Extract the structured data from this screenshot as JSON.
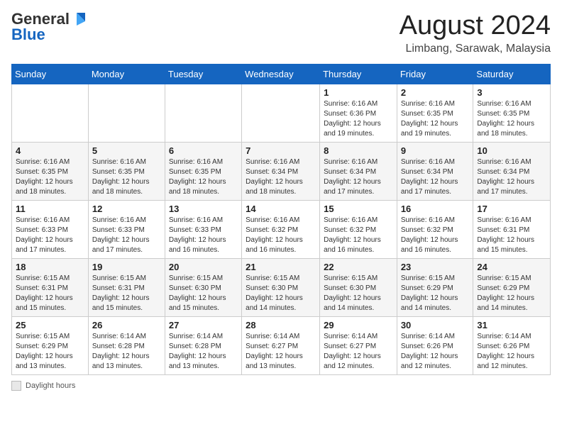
{
  "header": {
    "logo_general": "General",
    "logo_blue": "Blue",
    "month_year": "August 2024",
    "location": "Limbang, Sarawak, Malaysia"
  },
  "days_of_week": [
    "Sunday",
    "Monday",
    "Tuesday",
    "Wednesday",
    "Thursday",
    "Friday",
    "Saturday"
  ],
  "weeks": [
    [
      {
        "day": "",
        "info": ""
      },
      {
        "day": "",
        "info": ""
      },
      {
        "day": "",
        "info": ""
      },
      {
        "day": "",
        "info": ""
      },
      {
        "day": "1",
        "info": "Sunrise: 6:16 AM\nSunset: 6:36 PM\nDaylight: 12 hours\nand 19 minutes."
      },
      {
        "day": "2",
        "info": "Sunrise: 6:16 AM\nSunset: 6:35 PM\nDaylight: 12 hours\nand 19 minutes."
      },
      {
        "day": "3",
        "info": "Sunrise: 6:16 AM\nSunset: 6:35 PM\nDaylight: 12 hours\nand 18 minutes."
      }
    ],
    [
      {
        "day": "4",
        "info": "Sunrise: 6:16 AM\nSunset: 6:35 PM\nDaylight: 12 hours\nand 18 minutes."
      },
      {
        "day": "5",
        "info": "Sunrise: 6:16 AM\nSunset: 6:35 PM\nDaylight: 12 hours\nand 18 minutes."
      },
      {
        "day": "6",
        "info": "Sunrise: 6:16 AM\nSunset: 6:35 PM\nDaylight: 12 hours\nand 18 minutes."
      },
      {
        "day": "7",
        "info": "Sunrise: 6:16 AM\nSunset: 6:34 PM\nDaylight: 12 hours\nand 18 minutes."
      },
      {
        "day": "8",
        "info": "Sunrise: 6:16 AM\nSunset: 6:34 PM\nDaylight: 12 hours\nand 17 minutes."
      },
      {
        "day": "9",
        "info": "Sunrise: 6:16 AM\nSunset: 6:34 PM\nDaylight: 12 hours\nand 17 minutes."
      },
      {
        "day": "10",
        "info": "Sunrise: 6:16 AM\nSunset: 6:34 PM\nDaylight: 12 hours\nand 17 minutes."
      }
    ],
    [
      {
        "day": "11",
        "info": "Sunrise: 6:16 AM\nSunset: 6:33 PM\nDaylight: 12 hours\nand 17 minutes."
      },
      {
        "day": "12",
        "info": "Sunrise: 6:16 AM\nSunset: 6:33 PM\nDaylight: 12 hours\nand 17 minutes."
      },
      {
        "day": "13",
        "info": "Sunrise: 6:16 AM\nSunset: 6:33 PM\nDaylight: 12 hours\nand 16 minutes."
      },
      {
        "day": "14",
        "info": "Sunrise: 6:16 AM\nSunset: 6:32 PM\nDaylight: 12 hours\nand 16 minutes."
      },
      {
        "day": "15",
        "info": "Sunrise: 6:16 AM\nSunset: 6:32 PM\nDaylight: 12 hours\nand 16 minutes."
      },
      {
        "day": "16",
        "info": "Sunrise: 6:16 AM\nSunset: 6:32 PM\nDaylight: 12 hours\nand 16 minutes."
      },
      {
        "day": "17",
        "info": "Sunrise: 6:16 AM\nSunset: 6:31 PM\nDaylight: 12 hours\nand 15 minutes."
      }
    ],
    [
      {
        "day": "18",
        "info": "Sunrise: 6:15 AM\nSunset: 6:31 PM\nDaylight: 12 hours\nand 15 minutes."
      },
      {
        "day": "19",
        "info": "Sunrise: 6:15 AM\nSunset: 6:31 PM\nDaylight: 12 hours\nand 15 minutes."
      },
      {
        "day": "20",
        "info": "Sunrise: 6:15 AM\nSunset: 6:30 PM\nDaylight: 12 hours\nand 15 minutes."
      },
      {
        "day": "21",
        "info": "Sunrise: 6:15 AM\nSunset: 6:30 PM\nDaylight: 12 hours\nand 14 minutes."
      },
      {
        "day": "22",
        "info": "Sunrise: 6:15 AM\nSunset: 6:30 PM\nDaylight: 12 hours\nand 14 minutes."
      },
      {
        "day": "23",
        "info": "Sunrise: 6:15 AM\nSunset: 6:29 PM\nDaylight: 12 hours\nand 14 minutes."
      },
      {
        "day": "24",
        "info": "Sunrise: 6:15 AM\nSunset: 6:29 PM\nDaylight: 12 hours\nand 14 minutes."
      }
    ],
    [
      {
        "day": "25",
        "info": "Sunrise: 6:15 AM\nSunset: 6:29 PM\nDaylight: 12 hours\nand 13 minutes."
      },
      {
        "day": "26",
        "info": "Sunrise: 6:14 AM\nSunset: 6:28 PM\nDaylight: 12 hours\nand 13 minutes."
      },
      {
        "day": "27",
        "info": "Sunrise: 6:14 AM\nSunset: 6:28 PM\nDaylight: 12 hours\nand 13 minutes."
      },
      {
        "day": "28",
        "info": "Sunrise: 6:14 AM\nSunset: 6:27 PM\nDaylight: 12 hours\nand 13 minutes."
      },
      {
        "day": "29",
        "info": "Sunrise: 6:14 AM\nSunset: 6:27 PM\nDaylight: 12 hours\nand 12 minutes."
      },
      {
        "day": "30",
        "info": "Sunrise: 6:14 AM\nSunset: 6:26 PM\nDaylight: 12 hours\nand 12 minutes."
      },
      {
        "day": "31",
        "info": "Sunrise: 6:14 AM\nSunset: 6:26 PM\nDaylight: 12 hours\nand 12 minutes."
      }
    ]
  ],
  "footer": {
    "daylight_label": "Daylight hours"
  }
}
